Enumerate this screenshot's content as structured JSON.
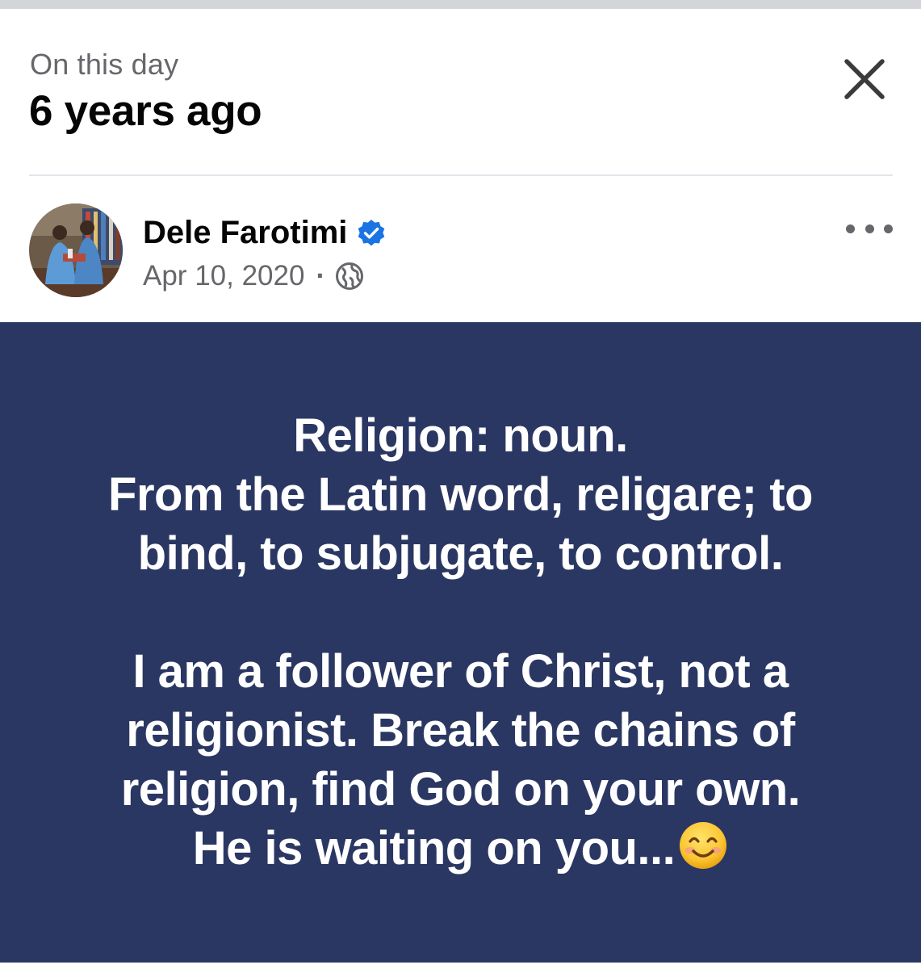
{
  "memory_header": {
    "kicker": "On this day",
    "headline": "6 years ago",
    "close_icon": "close-icon"
  },
  "post": {
    "author": "Dele Farotimi",
    "verified": true,
    "verified_icon": "verified-badge-icon",
    "date": "Apr 10, 2020",
    "separator": "·",
    "privacy_icon": "globe-icon",
    "more_icon": "more-options-icon",
    "background_color": "#2b3763",
    "text_lines": [
      "Religion: noun.",
      "From the Latin word, religare; to",
      "bind, to subjugate, to control.",
      "",
      "I am a follower of Christ, not a",
      "religionist. Break the chains of",
      "religion, find God on your own.",
      "He is waiting on you..."
    ],
    "trailing_emoji": "smiling-face-icon"
  },
  "colors": {
    "verified_blue": "#1b74e4",
    "secondary_text": "#65676b",
    "primary_text": "#050505"
  }
}
